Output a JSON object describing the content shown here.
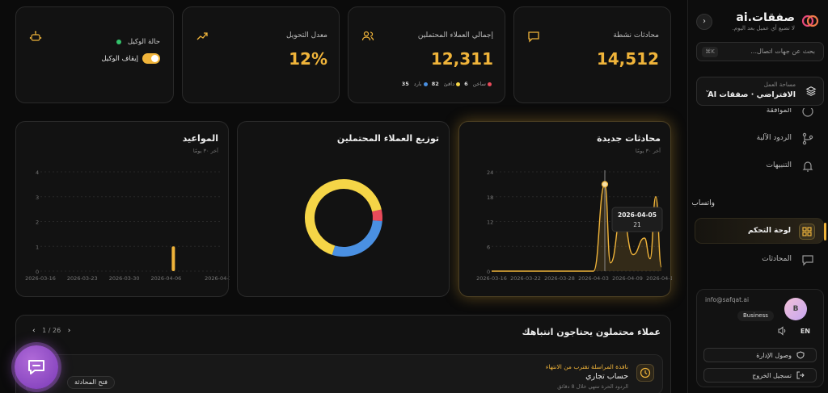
{
  "sidebar": {
    "brand": {
      "title": "صفقات.ai",
      "subtitle": "لا تضيع أي عميل بعد اليوم."
    },
    "collapse_icon": "chevron-left-icon",
    "search": {
      "placeholder": "بحث عن جهات اتصال...",
      "shortcut": "K⌘"
    },
    "workspace": {
      "label": "مساحة العمل",
      "value": "الافتراضي · صفقات AI"
    },
    "nav": [
      {
        "label": "الموافقة",
        "icon": "check-icon"
      },
      {
        "label": "الردود الآلية",
        "icon": "branch-icon"
      },
      {
        "label": "التنبيهات",
        "icon": "bell-icon"
      },
      {
        "label": "لوحة التحكم",
        "icon": "grid-icon",
        "active": true
      },
      {
        "label": "المحادثات",
        "icon": "chat-icon"
      }
    ],
    "section_whatsapp": "واتساب",
    "user": {
      "email": "info@safqat.ai",
      "avatar_letter": "B",
      "plan": "Business",
      "lang": "EN",
      "admin_access": "وصول الإدارة",
      "logout": "تسجيل الخروج"
    }
  },
  "stats": {
    "active_chats": {
      "title": "محادثات نشطة",
      "value": "14,512"
    },
    "total_leads": {
      "title": "إجمالي العملاء المحتملين",
      "value": "12,311",
      "hot_label": "ساخن",
      "hot_value": "6",
      "warm_label": "دافئ",
      "warm_value": "82",
      "cold_label": "بارد",
      "cold_value": "35"
    },
    "conversion": {
      "title": "معدل التحويل",
      "value": "12%"
    },
    "agent": {
      "title": "حالة الوكيل",
      "toggle_label": "إيقاف الوكيل"
    }
  },
  "charts_ui": {
    "new_chats": {
      "title": "محادثات جديدة",
      "subtitle": "آخر ٣٠ يومًا"
    },
    "distribution": {
      "title": "توزيع العملاء المحتملين"
    },
    "appointments": {
      "title": "المواعيد",
      "subtitle": "آخر ٣٠ يومًا"
    }
  },
  "chart_data": [
    {
      "type": "line",
      "title": "محادثات جديدة",
      "x": [
        "2026-03-16",
        "2026-03-22",
        "2026-03-28",
        "2026-04-03",
        "2026-04-05",
        "2026-04-06",
        "2026-04-08",
        "2026-04-10",
        "2026-04-12",
        "2026-04-13",
        "2026-04-14",
        "2026-04-15"
      ],
      "series": [
        {
          "values": [
            0,
            0,
            0,
            0,
            21,
            2,
            14,
            4,
            8,
            3,
            18,
            1
          ]
        }
      ],
      "x_ticks": [
        "2026-03-16",
        "2026-03-22",
        "2026-03-28",
        "2026-04-03",
        "2026-04-09",
        "2026-04-15"
      ],
      "y_ticks": [
        0,
        6,
        12,
        18,
        24
      ],
      "ylim": [
        0,
        24
      ],
      "tooltip": {
        "date": "2026-04-05",
        "value": "21"
      }
    },
    {
      "type": "pie",
      "title": "توزيع العملاء المحتملين",
      "categories": [
        "بارد",
        "دافئ",
        "ساخن"
      ],
      "values": [
        35,
        82,
        6
      ],
      "colors": [
        "#4a90e2",
        "#f5d547",
        "#e94b5a"
      ]
    },
    {
      "type": "bar",
      "title": "المواعيد",
      "x_ticks": [
        "2026-03-16",
        "2026-03-23",
        "2026-03-30",
        "2026-04-06",
        "2026-04-15"
      ],
      "y_ticks": [
        0,
        1,
        2,
        3,
        4
      ],
      "ylim": [
        0,
        4
      ],
      "bars": [
        {
          "date": "2026-04-06",
          "value": 1
        }
      ]
    }
  ],
  "attention": {
    "title": "عملاء محتملون يحتاجون انتباهك",
    "page": "1",
    "total": "26",
    "row": {
      "warning": "نافذة المراسلة تقترب من الانتهاء",
      "name": "حساب تجاري",
      "sub": "الردود الحرة تنتهي خلال 8 دقائق",
      "action": "فتح المحادثة"
    }
  },
  "colors": {
    "accent": "#f0b43a",
    "bg": "#0b0b0b",
    "card": "#121212"
  }
}
